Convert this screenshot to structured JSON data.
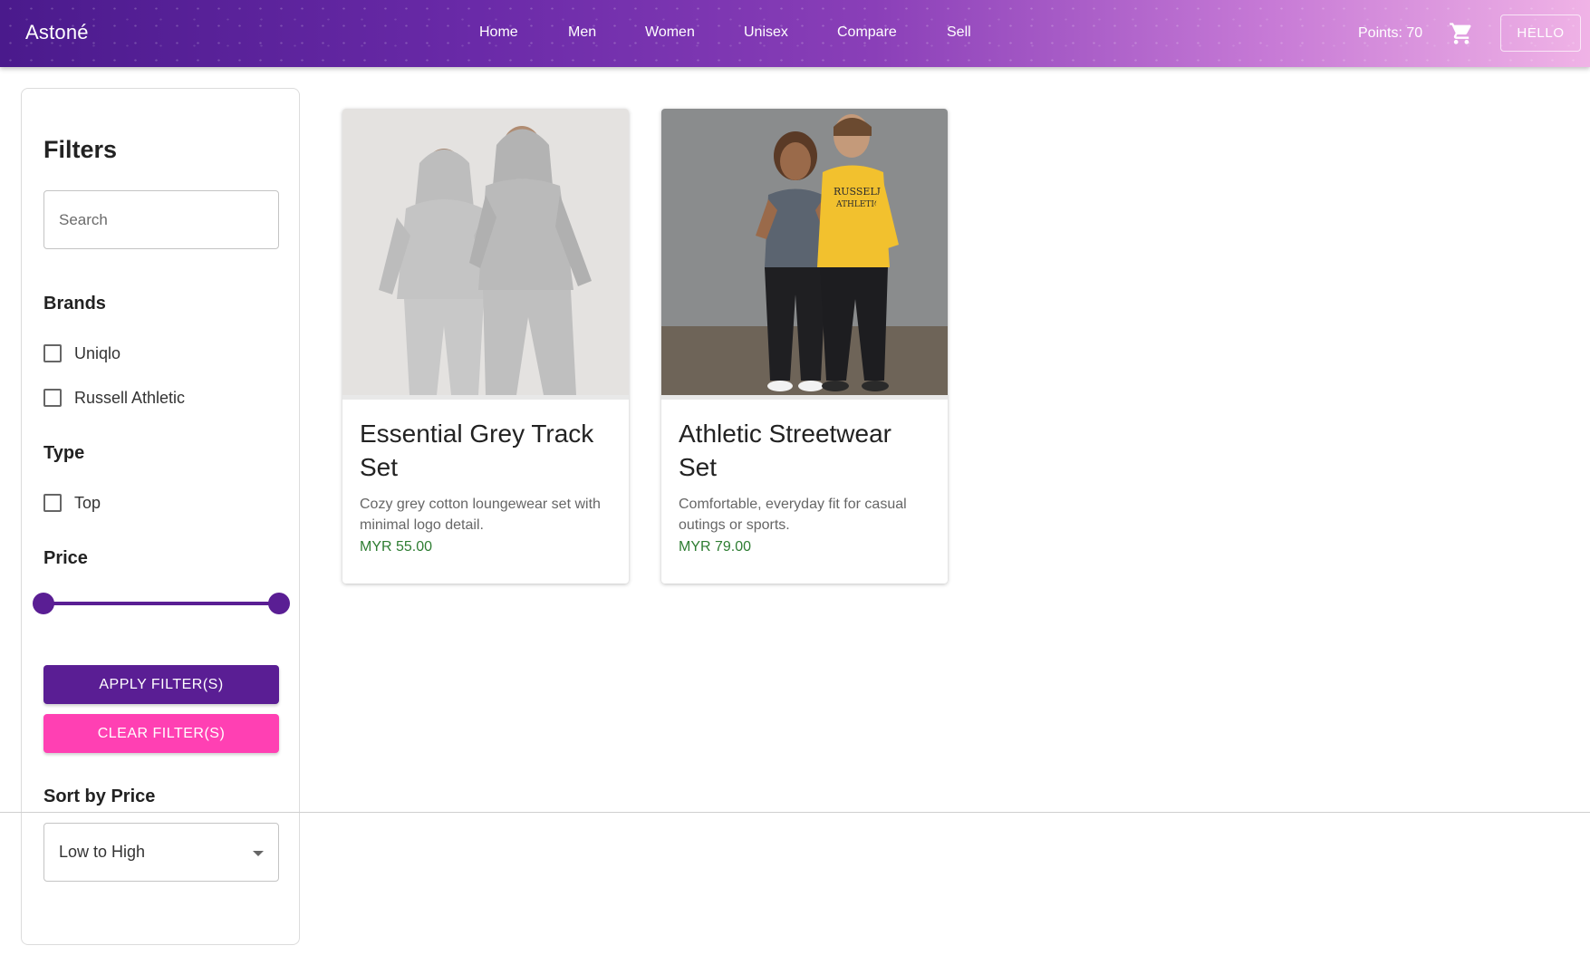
{
  "header": {
    "brand": "Astoné",
    "nav": [
      {
        "label": "Home"
      },
      {
        "label": "Men"
      },
      {
        "label": "Women"
      },
      {
        "label": "Unisex"
      },
      {
        "label": "Compare"
      },
      {
        "label": "Sell"
      }
    ],
    "points": "Points: 70",
    "cart_icon": "shopping-cart-icon",
    "user_button": "HELLO"
  },
  "sidebar": {
    "title": "Filters",
    "search_placeholder": "Search",
    "brands_title": "Brands",
    "brands": [
      {
        "label": "Uniqlo",
        "checked": false
      },
      {
        "label": "Russell Athletic",
        "checked": false
      }
    ],
    "type_title": "Type",
    "types": [
      {
        "label": "Top",
        "checked": false
      }
    ],
    "price_title": "Price",
    "price_range_fraction": [
      0,
      1
    ],
    "apply_label": "APPLY FILTER(S)",
    "clear_label": "CLEAR FILTER(S)",
    "sort_title": "Sort by Price",
    "sort_value": "Low to High"
  },
  "products": [
    {
      "title": "Essential Grey Track Set",
      "description": "Cozy grey cotton loungewear set with minimal logo detail.",
      "price": "MYR 55.00"
    },
    {
      "title": "Athletic Streetwear Set",
      "description": "Comfortable, everyday fit for casual outings or sports.",
      "price": "MYR 79.00"
    }
  ],
  "colors": {
    "primary": "#5a1e94",
    "accent": "#ff40b3",
    "price": "#2e7d32"
  }
}
